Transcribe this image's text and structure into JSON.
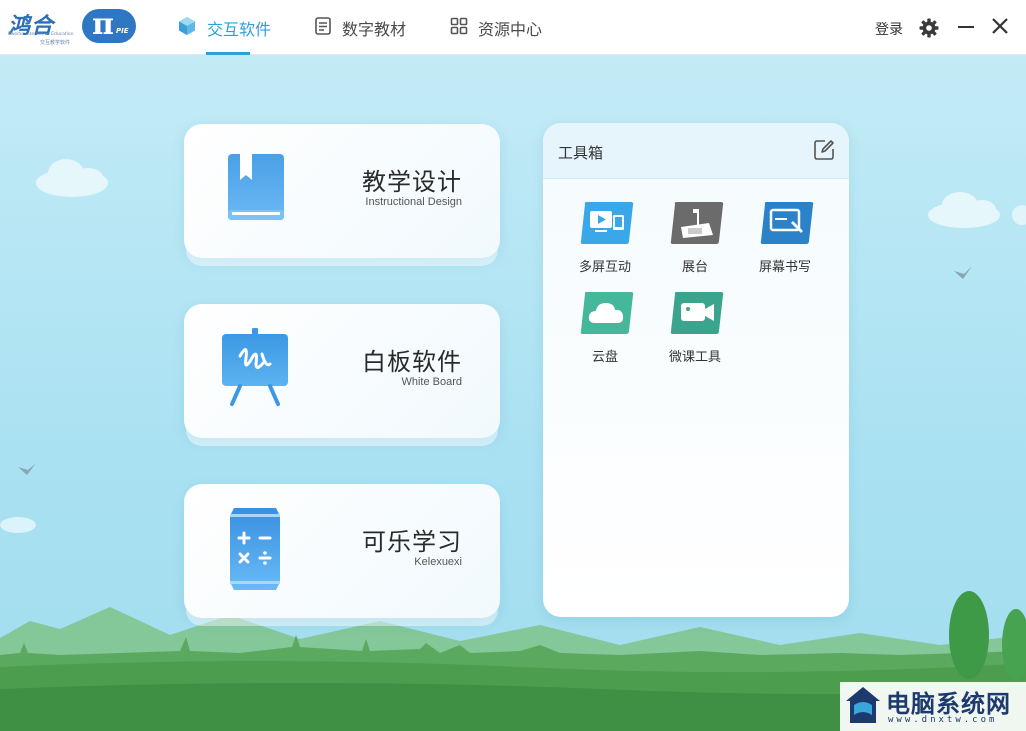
{
  "header": {
    "logo": {
      "cn": "鸿合",
      "en": "Pweiho Interactive Education",
      "sub": "交互教学软件",
      "pi": "π",
      "pie": "PIE"
    },
    "tabs": [
      {
        "label": "交互软件",
        "icon": "cube-icon",
        "active": true
      },
      {
        "label": "数字教材",
        "icon": "document-icon",
        "active": false
      },
      {
        "label": "资源中心",
        "icon": "grid-icon",
        "active": false
      }
    ],
    "login_label": "登录",
    "settings_icon": "gear-icon",
    "minimize_icon": "minimize-icon",
    "close_icon": "close-icon"
  },
  "cards": [
    {
      "title": "教学设计",
      "subtitle": "Instructional Design",
      "icon": "book-icon"
    },
    {
      "title": "白板软件",
      "subtitle": "White Board",
      "icon": "whiteboard-icon"
    },
    {
      "title": "可乐学习",
      "subtitle": "Kelexuexi",
      "icon": "calculator-can-icon"
    }
  ],
  "toolbox": {
    "title": "工具箱",
    "edit_icon": "edit-icon",
    "tools": [
      {
        "label": "多屏互动",
        "icon": "multiscreen-icon",
        "color": "#3aa7e8"
      },
      {
        "label": "展台",
        "icon": "document-camera-icon",
        "color": "#6b6b6b"
      },
      {
        "label": "屏幕书写",
        "icon": "screen-write-icon",
        "color": "#2b82c9"
      },
      {
        "label": "云盘",
        "icon": "cloud-icon",
        "color": "#45b79a"
      },
      {
        "label": "微课工具",
        "icon": "video-camera-icon",
        "color": "#3aa58c"
      }
    ]
  },
  "watermark": {
    "text": "电脑系统网",
    "url": "www.dnxtw.com"
  },
  "colors": {
    "accent": "#2e9fd8",
    "sky": "#b3e5f4",
    "grass": "#4a9e4a"
  }
}
